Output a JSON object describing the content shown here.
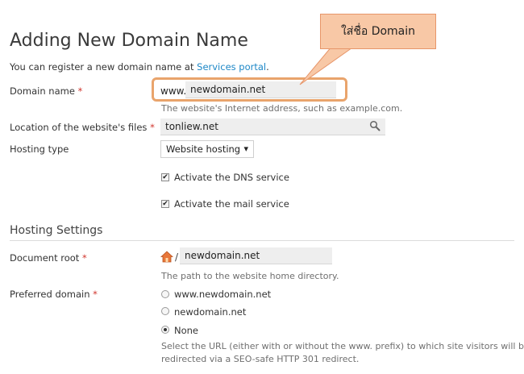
{
  "page": {
    "title": "Adding New Domain Name",
    "intro_text": "You can register a new domain name at",
    "intro_link": "Services portal",
    "intro_end": "."
  },
  "domain": {
    "label": "Domain name",
    "required_mark": "*",
    "prefix": "www.",
    "value": "newdomain.net",
    "hint": "The website's Internet address, such as example.com."
  },
  "location": {
    "label": "Location of the website's files",
    "required_mark": "*",
    "value": "tonliew.net",
    "icon": "search-icon"
  },
  "hosting_type": {
    "label": "Hosting type",
    "selected": "Website hosting",
    "caret": "▾"
  },
  "dns": {
    "label": "Activate the DNS service",
    "checked": true,
    "mark": "✔"
  },
  "mail": {
    "label": "Activate the mail service",
    "checked": true,
    "mark": "✔"
  },
  "hosting_settings": {
    "heading": "Hosting Settings"
  },
  "document_root": {
    "label": "Document root",
    "required_mark": "*",
    "icon": "home-icon",
    "separator": "/",
    "value": "newdomain.net",
    "hint": "The path to the website home directory."
  },
  "preferred_domain": {
    "label": "Preferred domain",
    "required_mark": "*",
    "options": [
      {
        "label": "www.newdomain.net",
        "selected": false
      },
      {
        "label": "newdomain.net",
        "selected": false
      },
      {
        "label": "None",
        "selected": true
      }
    ],
    "hint_line1": "Select the URL (either with or without the www. prefix) to which site visitors will be",
    "hint_line2": "redirected via a SEO-safe HTTP 301 redirect."
  },
  "annotation": {
    "callout_text": "ใส่ชื่อ Domain",
    "fill_color": "#f8c8a6",
    "border_color": "#e9a46c"
  },
  "colors": {
    "link": "#1e88c7",
    "required": "#d0342c",
    "hint": "#6f6f6f"
  }
}
